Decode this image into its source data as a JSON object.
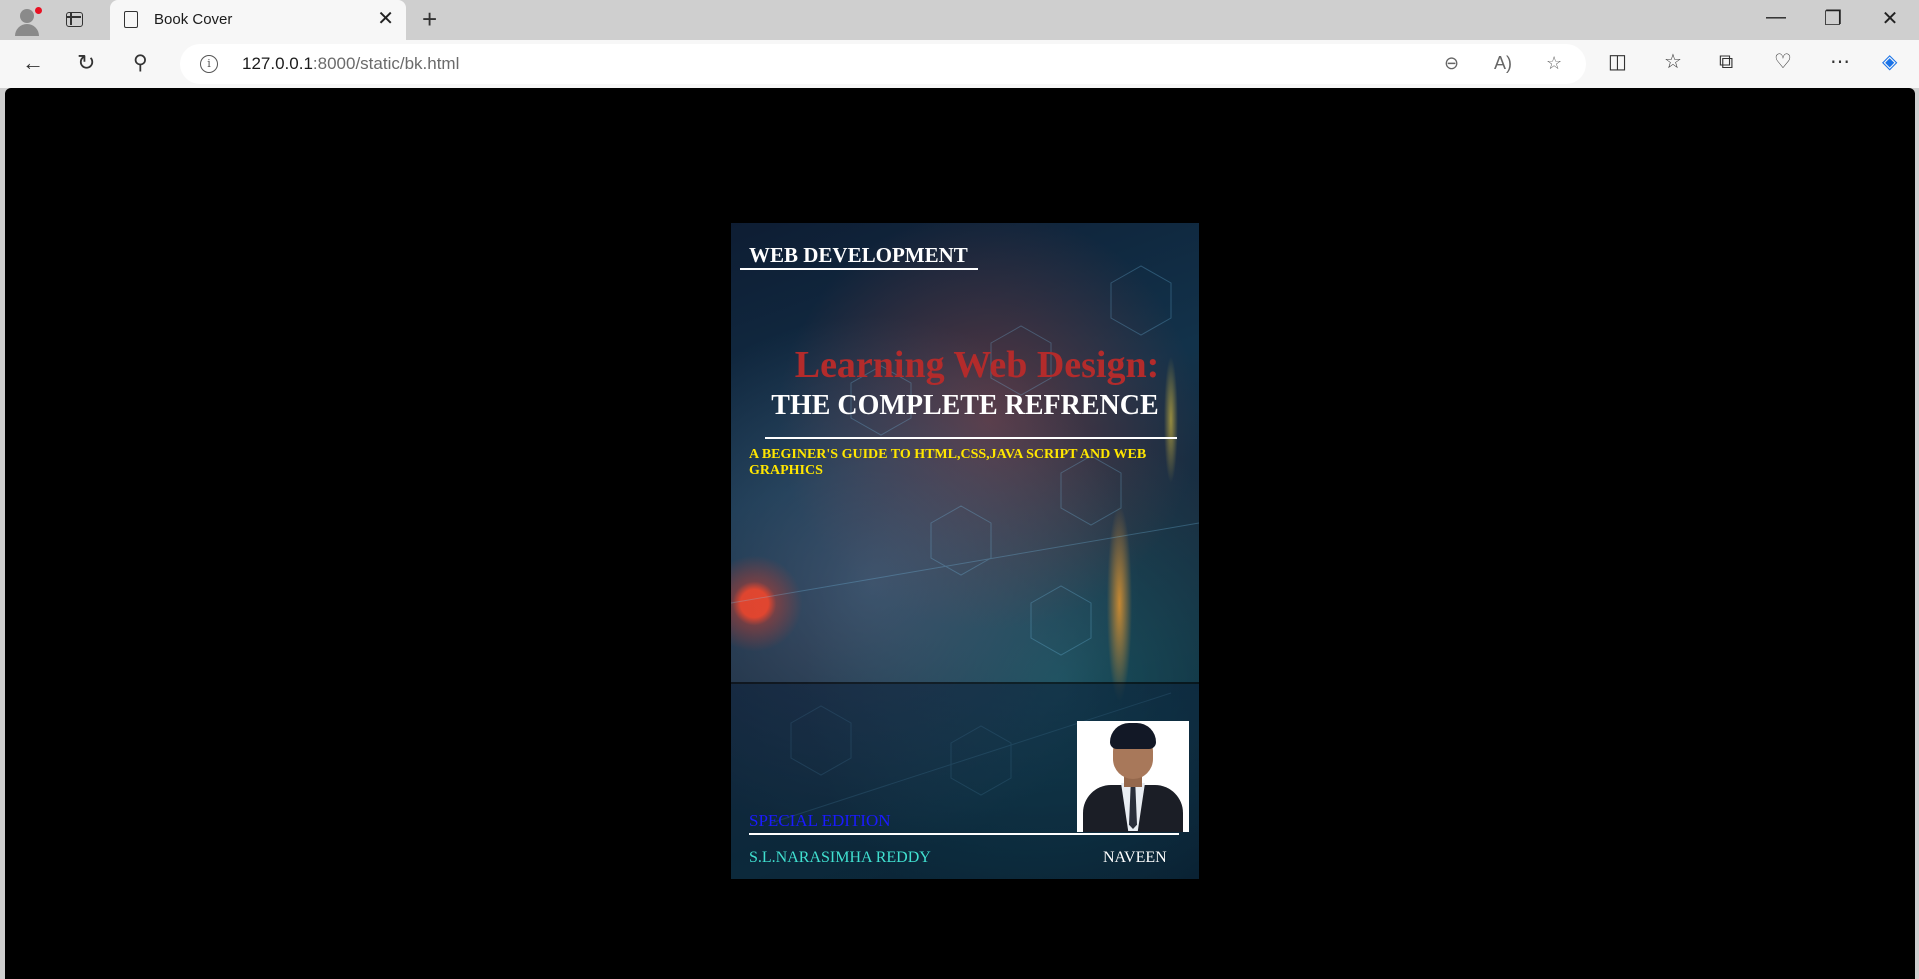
{
  "browser": {
    "tab_title": "Book Cover",
    "new_tab_label": "+",
    "url_host": "127.0.0.1",
    "url_rest": ":8000/static/bk.html"
  },
  "cover": {
    "series": "WEB DEVELOPMENT",
    "title": "Learning Web Design:",
    "subtitle_main": "THE COMPLETE REFRENCE",
    "tagline": "A BEGINER'S GUIDE TO HTML,CSS,JAVA SCRIPT AND WEB GRAPHICS",
    "edition": "SPECIAL EDITION",
    "author_left": "S.L.NARASIMHA REDDY",
    "author_right": "NAVEEN"
  },
  "icons": [
    "profile-avatar-icon",
    "tab-actions-icon",
    "page-icon",
    "close-icon",
    "new-tab-icon",
    "minimize-icon",
    "restore-icon",
    "window-close-icon",
    "back-icon",
    "refresh-icon",
    "search-icon",
    "site-info-icon",
    "zoom-out-icon",
    "read-aloud-icon",
    "favorite-star-icon",
    "split-screen-icon",
    "favorites-icon",
    "collections-icon",
    "browser-essentials-icon",
    "more-icon",
    "copilot-icon"
  ],
  "colors": {
    "title_red": "#b32b2b",
    "tagline_yellow": "#ffe600",
    "edition_blue": "#1a1aff",
    "author_cyan": "#40e0d0"
  }
}
